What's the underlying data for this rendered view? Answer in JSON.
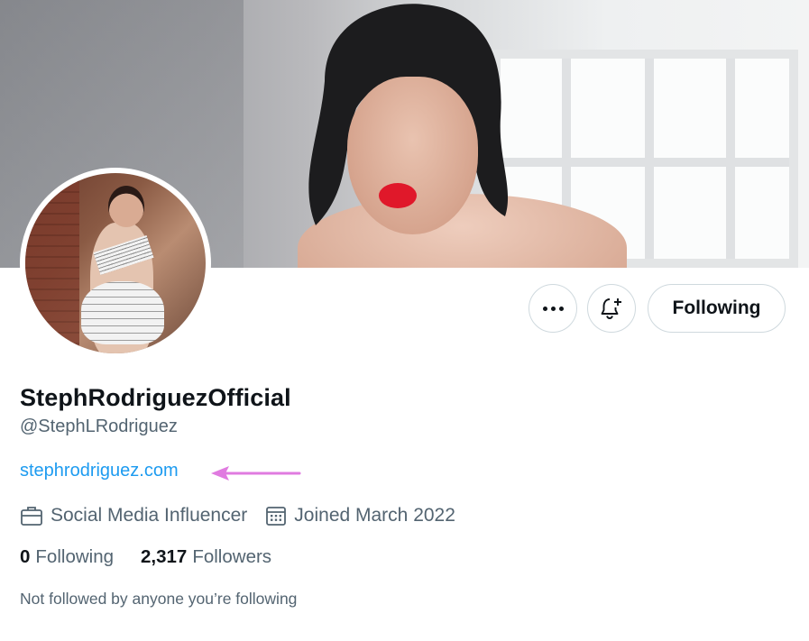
{
  "profile": {
    "display_name": "StephRodriguezOfficial",
    "handle": "@StephLRodriguez",
    "website": "stephrodriguez.com",
    "category": "Social Media Influencer",
    "joined": "Joined March 2022",
    "following_count": "0",
    "following_label": "Following",
    "followers_count": "2,317",
    "followers_label": "Followers",
    "mutuals_text": "Not followed by anyone you’re following"
  },
  "actions": {
    "more_icon": "more-horizontal-icon",
    "notify_icon": "bell-plus-icon",
    "follow_button_label": "Following"
  },
  "icons": {
    "category": "briefcase-icon",
    "joined": "calendar-icon"
  },
  "colors": {
    "link": "#1d9bf0",
    "secondary_text": "#536471",
    "annotation_arrow": "#e07be0"
  }
}
